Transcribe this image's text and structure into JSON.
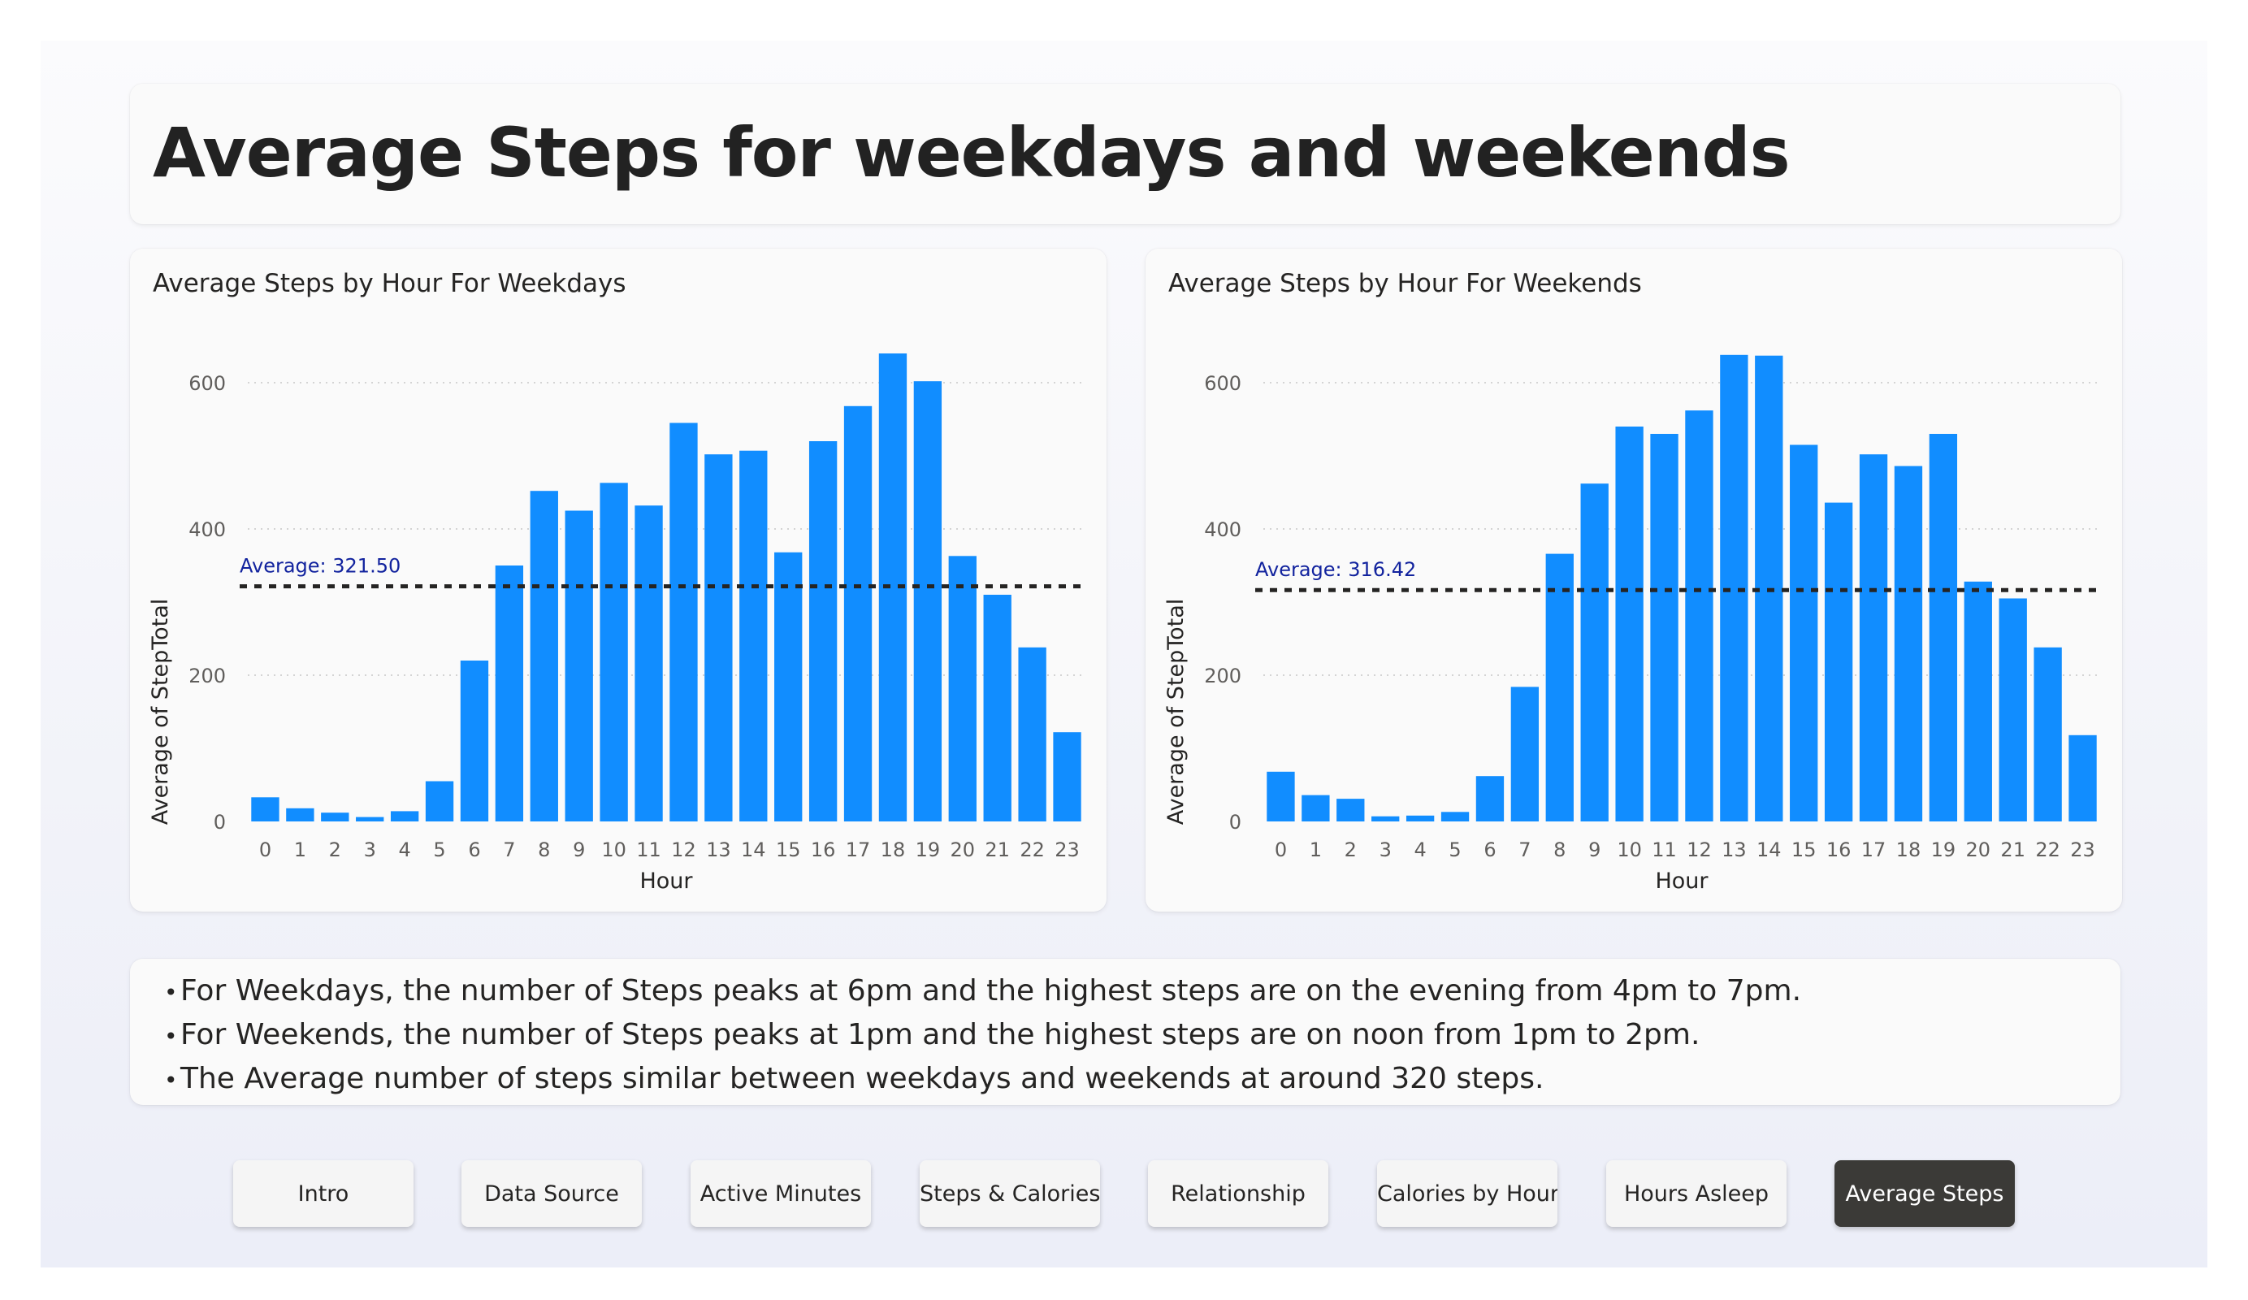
{
  "page": {
    "title": "Average Steps for weekdays and weekends"
  },
  "colors": {
    "bar": "#118DFF",
    "average_line": "#252423",
    "average_label": "#12239E",
    "active_button": "#3B3A37"
  },
  "chart_data": [
    {
      "type": "bar",
      "title": "Average Steps by Hour For Weekdays",
      "xlabel": "Hour",
      "ylabel": "Average of StepTotal",
      "categories": [
        "0",
        "1",
        "2",
        "3",
        "4",
        "5",
        "6",
        "7",
        "8",
        "9",
        "10",
        "11",
        "12",
        "13",
        "14",
        "15",
        "16",
        "17",
        "18",
        "19",
        "20",
        "21",
        "22",
        "23"
      ],
      "values": [
        33,
        18,
        12,
        6,
        14,
        55,
        220,
        350,
        452,
        425,
        463,
        432,
        545,
        502,
        507,
        368,
        520,
        568,
        640,
        602,
        363,
        310,
        238,
        122
      ],
      "ylim": [
        0,
        660
      ],
      "yticks": [
        0,
        200,
        400,
        600
      ],
      "grid": true,
      "reference_line": {
        "value": 321.5,
        "label": "Average: 321.50",
        "style": "dashed"
      }
    },
    {
      "type": "bar",
      "title": "Average Steps by Hour For Weekends",
      "xlabel": "Hour",
      "ylabel": "Average of StepTotal",
      "categories": [
        "0",
        "1",
        "2",
        "3",
        "4",
        "5",
        "6",
        "7",
        "8",
        "9",
        "10",
        "11",
        "12",
        "13",
        "14",
        "15",
        "16",
        "17",
        "18",
        "19",
        "20",
        "21",
        "22",
        "23"
      ],
      "values": [
        68,
        36,
        31,
        7,
        8,
        13,
        62,
        184,
        366,
        462,
        540,
        530,
        562,
        638,
        637,
        515,
        436,
        502,
        486,
        530,
        328,
        305,
        238,
        118
      ],
      "ylim": [
        0,
        660
      ],
      "yticks": [
        0,
        200,
        400,
        600
      ],
      "grid": true,
      "reference_line": {
        "value": 316.42,
        "label": "Average: 316.42",
        "style": "dashed"
      }
    }
  ],
  "insights": [
    "For Weekdays, the number of Steps peaks at 6pm and the highest steps are on the evening from 4pm to 7pm.",
    "For Weekends, the number of Steps peaks at 1pm and the highest steps are on noon from 1pm to 2pm.",
    "The Average number of steps similar between weekdays and weekends at around 320 steps."
  ],
  "bullet_char": "•",
  "nav": {
    "buttons": [
      {
        "label": "Intro",
        "active": false
      },
      {
        "label": "Data Source",
        "active": false
      },
      {
        "label": "Active Minutes",
        "active": false
      },
      {
        "label": "Steps & Calories",
        "active": false
      },
      {
        "label": "Relationship",
        "active": false
      },
      {
        "label": "Calories by Hour",
        "active": false
      },
      {
        "label": "Hours Asleep",
        "active": false
      },
      {
        "label": "Average Steps",
        "active": true
      }
    ]
  }
}
